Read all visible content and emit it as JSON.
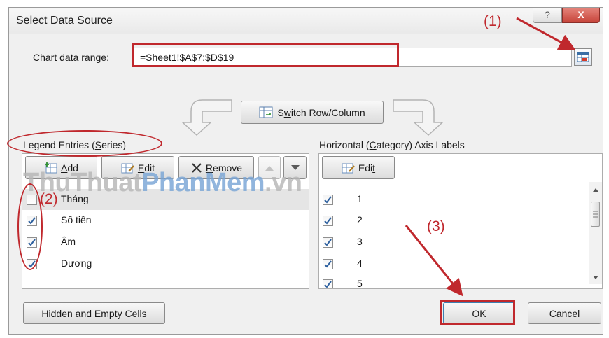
{
  "dialog": {
    "title": "Select Data Source",
    "help_label": "?",
    "close_label": "X"
  },
  "range": {
    "label_pre": "Chart ",
    "label_access": "d",
    "label_post": "ata range:",
    "value": "=Sheet1!$A$7:$D$19"
  },
  "switch_button": {
    "access": "w",
    "pre": "S",
    "post": "itch Row/Column"
  },
  "legend": {
    "title_pre": "Legend Entries (",
    "title_access": "S",
    "title_post": "eries)",
    "add_access": "A",
    "add_post": "dd",
    "edit_access": "E",
    "edit_post": "dit",
    "remove_access": "R",
    "remove_post": "emove",
    "items": [
      {
        "label": "Tháng",
        "checked": false
      },
      {
        "label": "Số tiền",
        "checked": true
      },
      {
        "label": "Âm",
        "checked": true
      },
      {
        "label": "Dương",
        "checked": true
      }
    ]
  },
  "axis": {
    "title_pre": "Horizontal (",
    "title_access": "C",
    "title_post": "ategory) Axis Labels",
    "edit_pre": "Edi",
    "edit_access": "t",
    "items": [
      {
        "label": "1",
        "checked": true
      },
      {
        "label": "2",
        "checked": true
      },
      {
        "label": "3",
        "checked": true
      },
      {
        "label": "4",
        "checked": true
      },
      {
        "label": "5",
        "checked": true
      }
    ]
  },
  "footer": {
    "hidden_access": "H",
    "hidden_post": "idden and Empty Cells",
    "ok_label": "OK",
    "cancel_label": "Cancel"
  },
  "annotations": {
    "callout_1": "(1)",
    "callout_2": "(2)",
    "callout_3": "(3)",
    "color": "#c0282d"
  },
  "watermark": {
    "part1": "ThuThuat",
    "part2": "PhanMem",
    "part3": ".vn"
  }
}
